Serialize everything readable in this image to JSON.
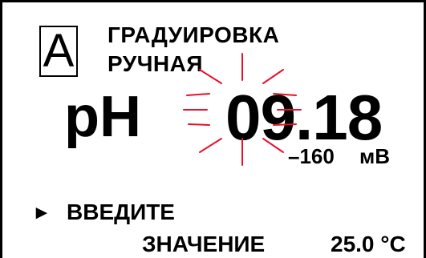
{
  "display": {
    "channel": "A",
    "mode_title": "ГРАДУИРОВКА",
    "mode_subtitle": "РУЧНАЯ",
    "parameter": "pH",
    "reading": "09.18",
    "millivolts": "–160",
    "millivolts_unit": "мВ",
    "prompt_arrow": "►",
    "prompt_line1": "ВВЕДИТЕ",
    "prompt_line2": "ЗНАЧЕНИЕ",
    "temperature": "25.0 °С"
  },
  "colors": {
    "blink_rays": "#e8102a",
    "text": "#000000",
    "background": "#ffffff"
  },
  "icons": {
    "blink_indicator": "blinking-rays-icon"
  }
}
